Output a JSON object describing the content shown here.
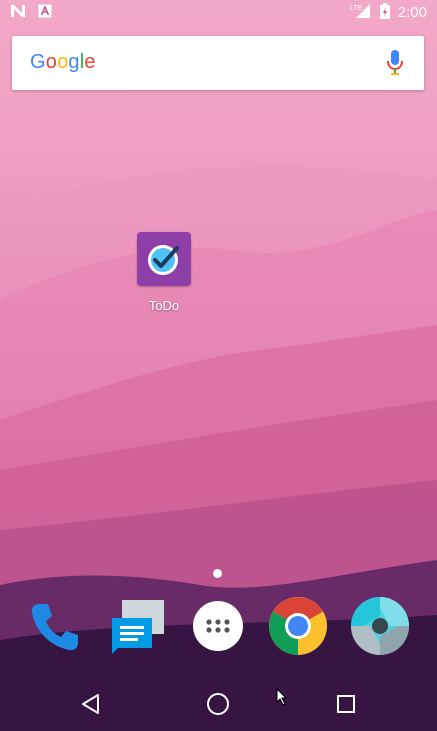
{
  "status_bar": {
    "time": "2:00",
    "network_label": "LTE",
    "left_icons": [
      "n-logo-icon",
      "a-icon"
    ],
    "right_icons": [
      "signal-icon",
      "battery-icon"
    ]
  },
  "search_widget": {
    "logo_text": [
      "G",
      "o",
      "o",
      "g",
      "l",
      "e"
    ],
    "logo_colors": [
      "#4285f4",
      "#ea4335",
      "#fbbc05",
      "#4285f4",
      "#34a853",
      "#ea4335"
    ],
    "mic_icon": "mic-icon"
  },
  "home_apps": [
    {
      "label": "ToDo",
      "icon": "todo-check-icon",
      "color": "#8e3ea7"
    }
  ],
  "page_indicator": {
    "current": 1,
    "total": 1
  },
  "dock": [
    {
      "name": "phone",
      "icon": "phone-icon",
      "color": "#1e88e5"
    },
    {
      "name": "messages",
      "icon": "messages-icon",
      "color": "#039be5"
    },
    {
      "name": "all-apps",
      "icon": "app-drawer-icon",
      "color": "#ffffff"
    },
    {
      "name": "chrome",
      "icon": "chrome-icon",
      "color": "#db4437"
    },
    {
      "name": "camera",
      "icon": "camera-icon",
      "color": "#4dd0e1"
    }
  ],
  "nav_bar": {
    "buttons": [
      "back-icon",
      "home-icon",
      "recents-icon"
    ]
  }
}
